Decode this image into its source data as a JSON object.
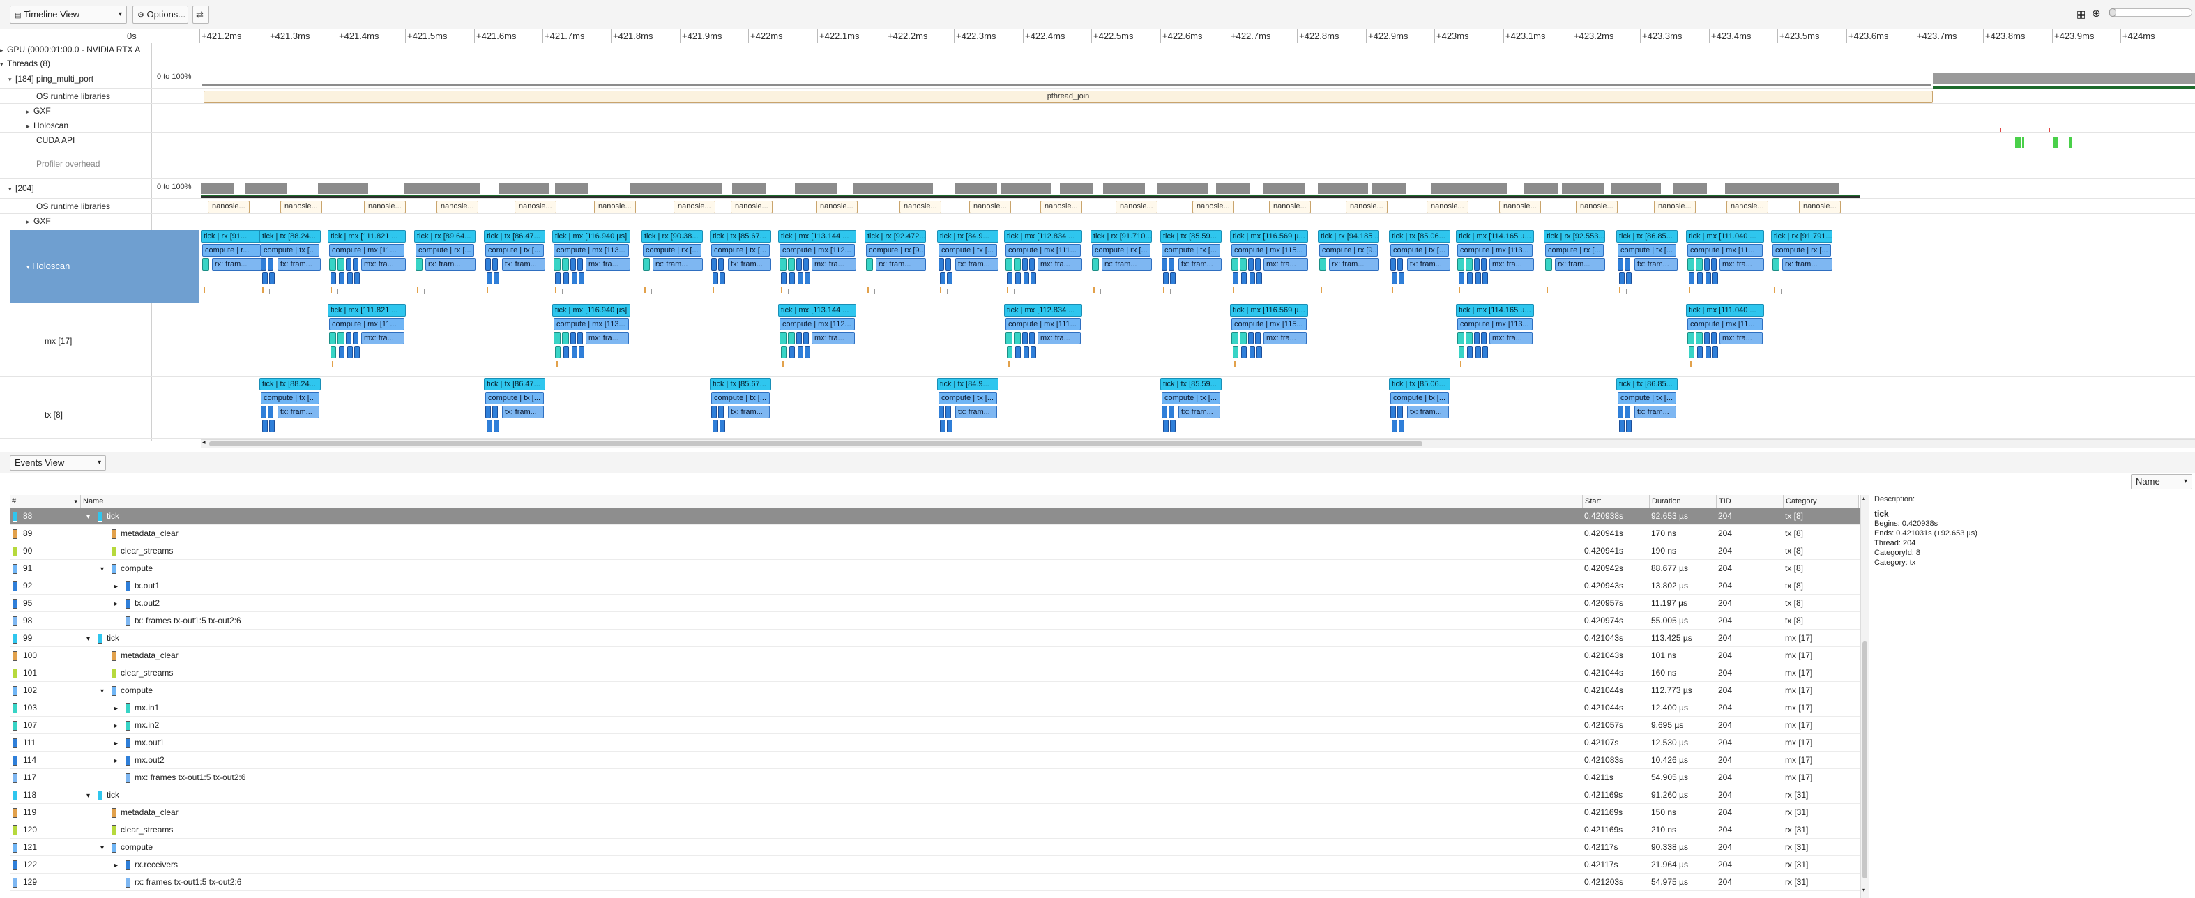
{
  "toolbar": {
    "view_select": "Timeline View",
    "options_button": "Options...",
    "right_icons": [
      "layout-icon",
      "zoom-icon",
      "slider-icon"
    ]
  },
  "ruler": {
    "origin": "0s",
    "ticks": [
      "+421.2ms",
      "+421.3ms",
      "+421.4ms",
      "+421.5ms",
      "+421.6ms",
      "+421.7ms",
      "+421.8ms",
      "+421.9ms",
      "+422ms",
      "+422.1ms",
      "+422.2ms",
      "+422.3ms",
      "+422.4ms",
      "+422.5ms",
      "+422.6ms",
      "+422.7ms",
      "+422.8ms",
      "+422.9ms",
      "+423ms",
      "+423.1ms",
      "+423.2ms",
      "+423.3ms",
      "+423.4ms",
      "+423.5ms",
      "+423.6ms",
      "+423.7ms",
      "+423.8ms",
      "+423.9ms",
      "+424ms"
    ]
  },
  "timeline": {
    "gpu_row": "GPU (0000:01:00.0 - NVIDIA RTX A",
    "threads_row": "Threads (8)",
    "proc184": "[184] ping_multi_port",
    "scale_label": "0 to 100%",
    "os_runtime": "OS runtime libraries",
    "gxf": "GXF",
    "holoscan": "Holoscan",
    "cuda_api": "CUDA API",
    "profiler_overhead": "Profiler overhead",
    "pthread_join": "pthread_join",
    "proc204": "[204]",
    "scale_label_2": "0 to 100%",
    "os_runtime_2": "OS runtime libraries",
    "gxf_2": "GXF",
    "holoscan_selected": "Holoscan",
    "mx_row": "mx [17]",
    "tx_row": "tx [8]",
    "nano_label": "nanosle...",
    "holoscan_ticks": [
      {
        "tick": "tick | rx [91...",
        "comp": "compute | r...",
        "frame": "rx: fram..."
      },
      {
        "tick": "tick | tx [88.24...",
        "comp": "compute | tx [..",
        "frame": "tx: fram..."
      },
      {
        "tick": "tick | mx [111.821 ...",
        "comp": "compute | mx [11...",
        "frame": "mx: fra..."
      },
      {
        "tick": "tick | rx [89.64...",
        "comp": "compute | rx [...",
        "frame": "rx: fram..."
      },
      {
        "tick": "tick | tx [86.47...",
        "comp": "compute | tx [...",
        "frame": "tx: fram..."
      },
      {
        "tick": "tick | mx [116.940 µs]",
        "comp": "compute | mx [113...",
        "frame": "mx: fra..."
      },
      {
        "tick": "tick | rx [90.38...",
        "comp": "compute | rx [...",
        "frame": "rx: fram..."
      },
      {
        "tick": "tick | tx [85.67...",
        "comp": "compute | tx [...",
        "frame": "tx: fram..."
      },
      {
        "tick": "tick | mx [113.144 ...",
        "comp": "compute | mx [112...",
        "frame": "mx: fra..."
      },
      {
        "tick": "tick | rx [92.472...",
        "comp": "compute | rx [9...",
        "frame": "rx: fram..."
      },
      {
        "tick": "tick | tx [84.9...",
        "comp": "compute | tx [...",
        "frame": "tx: fram..."
      },
      {
        "tick": "tick | mx [112.834 ...",
        "comp": "compute | mx [111...",
        "frame": "mx: fra..."
      },
      {
        "tick": "tick | rx [91.710...",
        "comp": "compute | rx [...",
        "frame": "rx: fram..."
      },
      {
        "tick": "tick | tx [85.59...",
        "comp": "compute | tx [...",
        "frame": "tx: fram..."
      },
      {
        "tick": "tick | mx [116.569 µ...",
        "comp": "compute | mx [115...",
        "frame": "mx: fra..."
      },
      {
        "tick": "tick | rx [94.185 ...",
        "comp": "compute | rx [9...",
        "frame": "rx: fram..."
      },
      {
        "tick": "tick | tx [85.06...",
        "comp": "compute | tx [...",
        "frame": "tx: fram..."
      },
      {
        "tick": "tick | mx [114.165 µ...",
        "comp": "compute | mx [113...",
        "frame": "mx: fra..."
      },
      {
        "tick": "tick | rx [92.553...",
        "comp": "compute | rx [...",
        "frame": "rx: fram..."
      },
      {
        "tick": "tick | tx [86.85...",
        "comp": "compute | tx [...",
        "frame": "tx: fram..."
      },
      {
        "tick": "tick | mx [111.040 ...",
        "comp": "compute | mx [11...",
        "frame": "mx: fra..."
      },
      {
        "tick": "tick | rx [91.791...",
        "comp": "compute | rx [...",
        "frame": "rx: fram..."
      }
    ]
  },
  "events_view": {
    "select_label": "Events View",
    "sort_select": "Name",
    "columns": [
      "#",
      "Name",
      "Start",
      "Duration",
      "TID",
      "Category"
    ],
    "description_header": "Description:",
    "description": {
      "title": "tick",
      "begins": "Begins: 0.420938s",
      "ends": "Ends: 0.421031s (+92.653 µs)",
      "thread": "Thread: 204",
      "category_id": "CategoryId: 8",
      "category": "Category: tx"
    },
    "rows": [
      {
        "id": "88",
        "indent": 0,
        "expander": "▾",
        "name": "tick",
        "start": "0.420938s",
        "duration": "92.653 µs",
        "tid": "204",
        "cat": "tx [8]",
        "color": "#2fc6ee",
        "sel": true
      },
      {
        "id": "89",
        "indent": 1,
        "expander": "",
        "name": "metadata_clear",
        "start": "0.420941s",
        "duration": "170 ns",
        "tid": "204",
        "cat": "tx [8]",
        "color": "#e2a14b"
      },
      {
        "id": "90",
        "indent": 1,
        "expander": "",
        "name": "clear_streams",
        "start": "0.420941s",
        "duration": "190 ns",
        "tid": "204",
        "cat": "tx [8]",
        "color": "#b6d93c"
      },
      {
        "id": "91",
        "indent": 1,
        "expander": "▾",
        "name": "compute",
        "start": "0.420942s",
        "duration": "88.677 µs",
        "tid": "204",
        "cat": "tx [8]",
        "color": "#6fb5f5"
      },
      {
        "id": "92",
        "indent": 2,
        "expander": "▸",
        "name": "tx.out1",
        "start": "0.420943s",
        "duration": "13.802 µs",
        "tid": "204",
        "cat": "tx [8]",
        "color": "#2f7fd9"
      },
      {
        "id": "95",
        "indent": 2,
        "expander": "▸",
        "name": "tx.out2",
        "start": "0.420957s",
        "duration": "11.197 µs",
        "tid": "204",
        "cat": "tx [8]",
        "color": "#2f7fd9"
      },
      {
        "id": "98",
        "indent": 2,
        "expander": "",
        "name": "tx: frames tx-out1:5 tx-out2:6",
        "start": "0.420974s",
        "duration": "55.005 µs",
        "tid": "204",
        "cat": "tx [8]",
        "color": "#7eb7f2"
      },
      {
        "id": "99",
        "indent": 0,
        "expander": "▾",
        "name": "tick",
        "start": "0.421043s",
        "duration": "113.425 µs",
        "tid": "204",
        "cat": "mx [17]",
        "color": "#2fc6ee"
      },
      {
        "id": "100",
        "indent": 1,
        "expander": "",
        "name": "metadata_clear",
        "start": "0.421043s",
        "duration": "101 ns",
        "tid": "204",
        "cat": "mx [17]",
        "color": "#e2a14b"
      },
      {
        "id": "101",
        "indent": 1,
        "expander": "",
        "name": "clear_streams",
        "start": "0.421044s",
        "duration": "160 ns",
        "tid": "204",
        "cat": "mx [17]",
        "color": "#b6d93c"
      },
      {
        "id": "102",
        "indent": 1,
        "expander": "▾",
        "name": "compute",
        "start": "0.421044s",
        "duration": "112.773 µs",
        "tid": "204",
        "cat": "mx [17]",
        "color": "#6fb5f5"
      },
      {
        "id": "103",
        "indent": 2,
        "expander": "▸",
        "name": "mx.in1",
        "start": "0.421044s",
        "duration": "12.400 µs",
        "tid": "204",
        "cat": "mx [17]",
        "color": "#38d4c6"
      },
      {
        "id": "107",
        "indent": 2,
        "expander": "▸",
        "name": "mx.in2",
        "start": "0.421057s",
        "duration": "9.695 µs",
        "tid": "204",
        "cat": "mx [17]",
        "color": "#38d4c6"
      },
      {
        "id": "111",
        "indent": 2,
        "expander": "▸",
        "name": "mx.out1",
        "start": "0.42107s",
        "duration": "12.530 µs",
        "tid": "204",
        "cat": "mx [17]",
        "color": "#2f7fd9"
      },
      {
        "id": "114",
        "indent": 2,
        "expander": "▸",
        "name": "mx.out2",
        "start": "0.421083s",
        "duration": "10.426 µs",
        "tid": "204",
        "cat": "mx [17]",
        "color": "#2f7fd9"
      },
      {
        "id": "117",
        "indent": 2,
        "expander": "",
        "name": "mx: frames tx-out1:5 tx-out2:6",
        "start": "0.4211s",
        "duration": "54.905 µs",
        "tid": "204",
        "cat": "mx [17]",
        "color": "#7eb7f2"
      },
      {
        "id": "118",
        "indent": 0,
        "expander": "▾",
        "name": "tick",
        "start": "0.421169s",
        "duration": "91.260 µs",
        "tid": "204",
        "cat": "rx [31]",
        "color": "#2fc6ee"
      },
      {
        "id": "119",
        "indent": 1,
        "expander": "",
        "name": "metadata_clear",
        "start": "0.421169s",
        "duration": "150 ns",
        "tid": "204",
        "cat": "rx [31]",
        "color": "#e2a14b"
      },
      {
        "id": "120",
        "indent": 1,
        "expander": "",
        "name": "clear_streams",
        "start": "0.421169s",
        "duration": "210 ns",
        "tid": "204",
        "cat": "rx [31]",
        "color": "#b6d93c"
      },
      {
        "id": "121",
        "indent": 1,
        "expander": "▾",
        "name": "compute",
        "start": "0.42117s",
        "duration": "90.338 µs",
        "tid": "204",
        "cat": "rx [31]",
        "color": "#6fb5f5"
      },
      {
        "id": "122",
        "indent": 2,
        "expander": "▸",
        "name": "rx.receivers",
        "start": "0.42117s",
        "duration": "21.964 µs",
        "tid": "204",
        "cat": "rx [31]",
        "color": "#2f7fd9"
      },
      {
        "id": "129",
        "indent": 2,
        "expander": "",
        "name": "rx: frames tx-out1:5 tx-out2:6",
        "start": "0.421203s",
        "duration": "54.975 µs",
        "tid": "204",
        "cat": "rx [31]",
        "color": "#7eb7f2"
      }
    ]
  },
  "colors": {
    "tick": "#2fc6ee",
    "compute": "#6fb5f5",
    "selection": "#6f9fd0",
    "os_runtime": "#8c8c8c",
    "cuda": "#4ad04a"
  }
}
